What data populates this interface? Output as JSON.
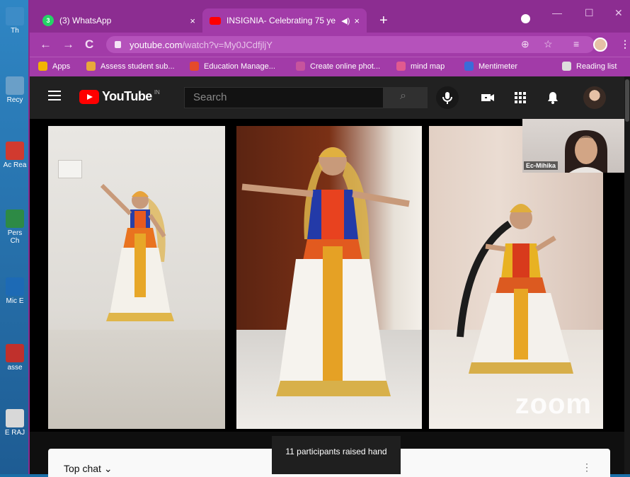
{
  "desktop": {
    "icons": [
      {
        "label": "Th",
        "color": "#3d8cc7"
      },
      {
        "label": "Recy",
        "color": "#6a9fc8"
      },
      {
        "label": "Ac Rea",
        "color": "#d13a2f"
      },
      {
        "label": "Pers Ch",
        "color": "#2d8a45"
      },
      {
        "label": "Mic E",
        "color": "#1d6ab5"
      },
      {
        "label": "asse",
        "color": "#c0302c"
      },
      {
        "label": "E RAJ",
        "color": "#d8d8d8"
      }
    ]
  },
  "browser": {
    "tabs": [
      {
        "title": "(3) WhatsApp",
        "badge": "3",
        "close": "×"
      },
      {
        "title": "INSIGNIA- Celebrating 75 ye",
        "close": "×"
      }
    ],
    "new_tab": "+",
    "window_controls": {
      "minimize": "—",
      "maximize": "☐",
      "close": "✕"
    },
    "nav": {
      "back": "←",
      "forward": "→",
      "reload": "C"
    },
    "url_host": "youtube.com",
    "url_rest": "/watch?v=My0JCdfjljY",
    "addr_icons": {
      "install": "⊕",
      "star": "☆",
      "queue": "≡",
      "menu": "⋮"
    },
    "bookmarks": [
      {
        "label": "Apps",
        "color": "#f2b400"
      },
      {
        "label": "Assess student sub...",
        "color": "#e8a83a"
      },
      {
        "label": "Education Manage...",
        "color": "#e54a2b"
      },
      {
        "label": "Create online phot...",
        "color": "#c7549d"
      },
      {
        "label": "mind map",
        "color": "#e05a8f"
      },
      {
        "label": "Mentimeter",
        "color": "#3b6cd9"
      },
      {
        "label": "Reading list",
        "color": "#dddddd"
      }
    ]
  },
  "youtube": {
    "logo_text": "YouTube",
    "country": "IN",
    "search_placeholder": "Search",
    "icons": {
      "search": "⌕",
      "create": "▣",
      "apps": "⋮⋮⋮",
      "bell": "🔔"
    }
  },
  "video": {
    "participant_name": "Ec-Mihika",
    "watermark": "zoom",
    "toast": "11 participants raised hand"
  },
  "chat": {
    "label": "Top chat",
    "chevron": "⌄",
    "menu": "⋮"
  }
}
